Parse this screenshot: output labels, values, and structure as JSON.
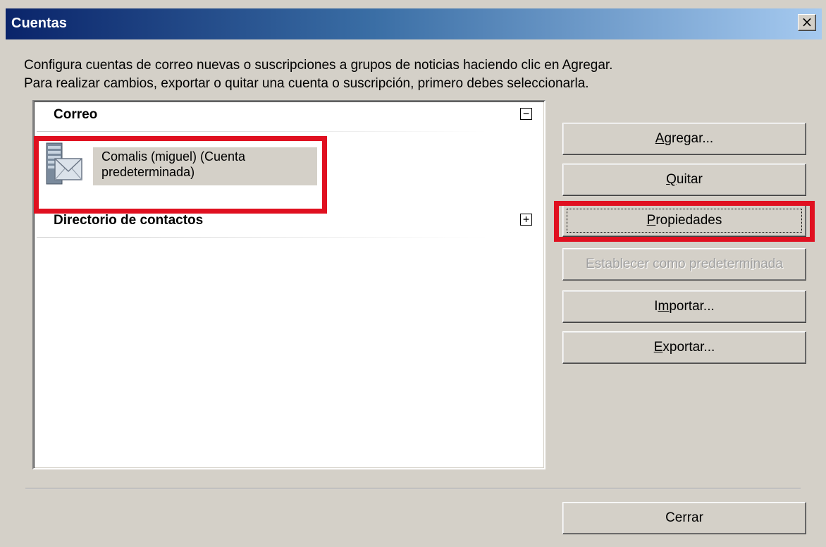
{
  "window": {
    "title": "Cuentas",
    "close_glyph": "×"
  },
  "intro": {
    "line1": "Configura cuentas de correo nuevas o suscripciones a grupos de noticias haciendo clic en Agregar.",
    "line2": "Para realizar cambios, exportar o quitar una cuenta o suscripción, primero debes seleccionarla."
  },
  "accounts": {
    "groups": [
      {
        "label": "Correo",
        "expander": "−",
        "expanded": true,
        "items": [
          {
            "line1": "Comalis (miguel) (Cuenta",
            "line2": "predeterminada)",
            "icon": "mail-server-icon",
            "selected": true
          }
        ]
      },
      {
        "label": "Directorio de contactos",
        "expander": "+",
        "expanded": false,
        "items": []
      }
    ]
  },
  "buttons": {
    "agregar": {
      "before": "",
      "mnemonic": "A",
      "after": "gregar...",
      "enabled": true
    },
    "quitar": {
      "before": "",
      "mnemonic": "Q",
      "after": "uitar",
      "enabled": true
    },
    "propiedades": {
      "before": "",
      "mnemonic": "P",
      "after": "ropiedades",
      "enabled": true,
      "focused": true
    },
    "establecer": {
      "before": "Establecer como predeterm",
      "mnemonic": "i",
      "after": "nada",
      "enabled": false
    },
    "importar": {
      "before": "I",
      "mnemonic": "m",
      "after": "portar...",
      "enabled": true
    },
    "exportar": {
      "before": "",
      "mnemonic": "E",
      "after": "xportar...",
      "enabled": true
    },
    "cerrar": {
      "label": "Cerrar",
      "enabled": true
    }
  },
  "highlight_color": "#e01020",
  "titlebar_color": "#0a246a"
}
